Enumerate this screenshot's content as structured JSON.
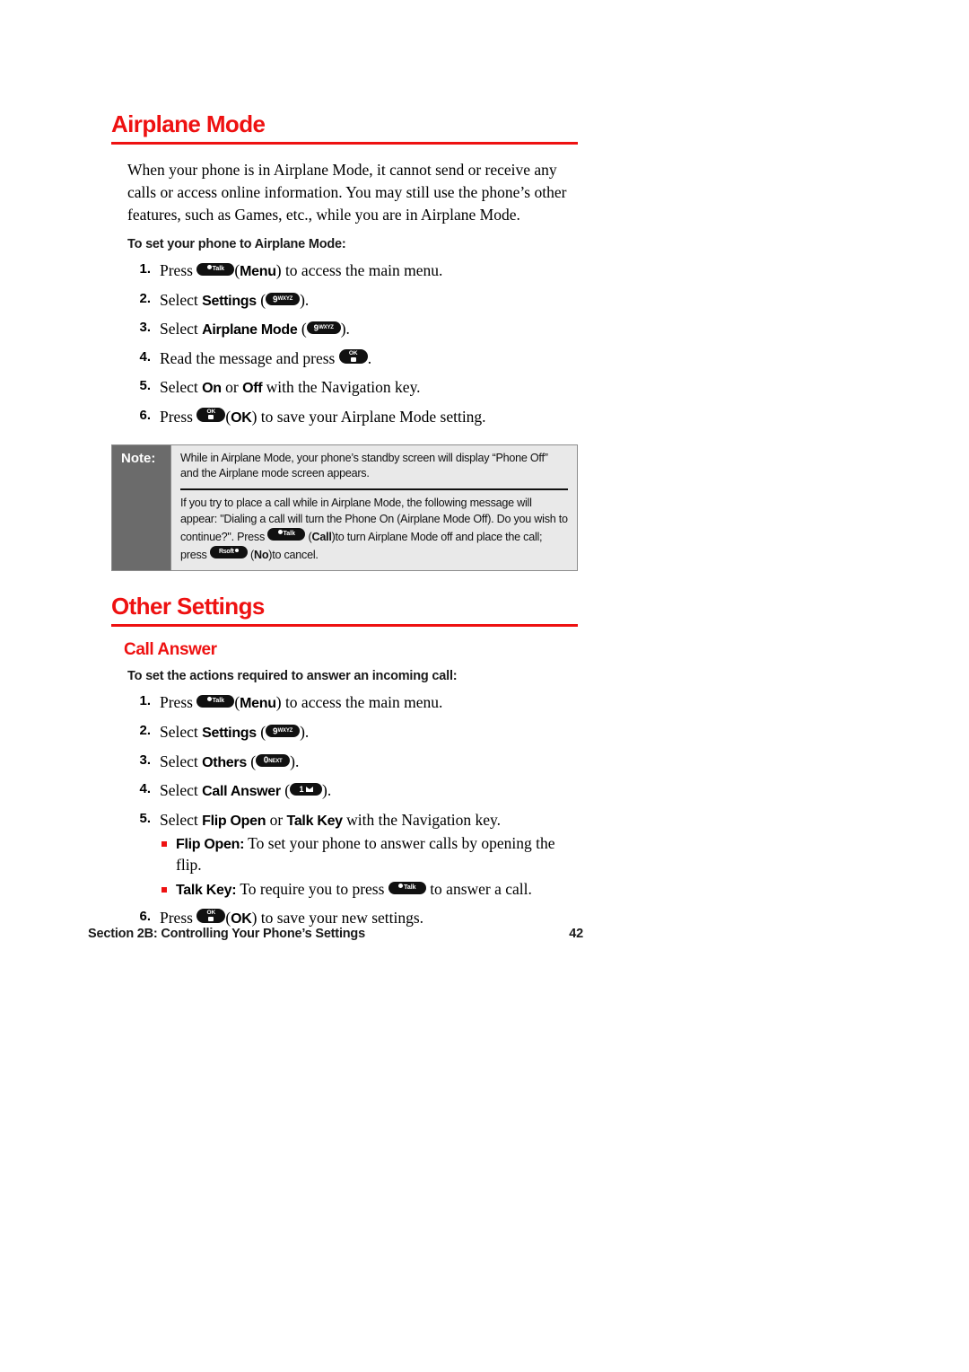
{
  "page": {
    "section_footer": "Section 2B: Controlling Your Phone’s Settings",
    "page_number": "42",
    "accent_color": "#ee1111"
  },
  "airplane": {
    "heading": "Airplane Mode",
    "intro": "When your phone is in Airplane Mode, it cannot send or receive any calls or access online information. You may still use the phone’s other features, such as Games, etc., while you are in Airplane Mode.",
    "lead_in": "To set your phone to Airplane Mode:",
    "steps": [
      {
        "num": "1.",
        "pre": "Press",
        "key": "talk-key",
        "key_label": "Talk",
        "paren_open": "(",
        "paren_label": "Menu",
        "paren_close": ")",
        "post": "to access the main menu."
      },
      {
        "num": "2.",
        "pre": "Select",
        "target": "Settings",
        "key": "key-9-wxyz",
        "key_digit": "9",
        "key_sub": "WXYZ",
        "post": "."
      },
      {
        "num": "3.",
        "pre": "Select",
        "target": "Airplane Mode",
        "key": "key-9-wxyz",
        "key_digit": "9",
        "key_sub": "WXYZ",
        "post": "."
      },
      {
        "num": "4.",
        "pre": "Read the message and press",
        "key": "ok-key",
        "key_label": "OK",
        "post": "."
      },
      {
        "num": "5.",
        "pre": "Select",
        "opt_a": "On",
        "conj": "or",
        "opt_b": "Off",
        "post": "with the Navigation key."
      },
      {
        "num": "6.",
        "pre": "Press",
        "key": "ok-key",
        "key_label": "OK",
        "paren_open": "(",
        "paren_label": "OK",
        "paren_close": ")",
        "post": "to save your Airplane Mode setting."
      }
    ],
    "note": {
      "label": "Note:",
      "para1": "While in Airplane Mode, your phone’s standby screen will display “Phone Off” and the Airplane mode screen appears.",
      "para2_a": "If you try to place a call while in Airplane Mode, the following message will appear: \"Dialing a call will turn the Phone On (Airplane Mode Off). Do you wish to continue?\".  Press",
      "para2_call_label": "Call",
      "para2_b": "to turn Airplane Mode off and place the call; press",
      "para2_no_label": "No",
      "para2_c": "to cancel."
    }
  },
  "other_settings": {
    "heading": "Other Settings",
    "subheading": "Call Answer",
    "lead_in": "To set the actions required to answer an incoming call:",
    "steps": [
      {
        "num": "1.",
        "pre": "Press",
        "key": "talk-key",
        "key_label": "Talk",
        "paren_open": "(",
        "paren_label": "Menu",
        "paren_close": ")",
        "post": "to access the main menu."
      },
      {
        "num": "2.",
        "pre": "Select",
        "target": "Settings",
        "key": "key-9-wxyz",
        "key_digit": "9",
        "key_sub": "WXYZ",
        "post": "."
      },
      {
        "num": "3.",
        "pre": "Select",
        "target": "Others",
        "key": "key-0-next",
        "key_digit": "0",
        "key_sub": "NEXT",
        "post": "."
      },
      {
        "num": "4.",
        "pre": "Select",
        "target": "Call Answer",
        "key": "key-1-envelope",
        "key_digit": "1",
        "post": "."
      },
      {
        "num": "5.",
        "pre": "Select",
        "opt_a": "Flip Open",
        "conj": "or",
        "opt_b": "Talk Key",
        "post": "with the Navigation key."
      }
    ],
    "bullets": [
      {
        "term": "Flip Open:",
        "text": "To set your phone to answer calls by opening the flip."
      },
      {
        "term": "Talk Key:",
        "pre": "To require you to press",
        "key": "talk-key",
        "key_label": "Talk",
        "post": "to answer a call."
      }
    ],
    "final_step": {
      "num": "6.",
      "pre": "Press",
      "key": "ok-key",
      "key_label": "OK",
      "paren_open": "(",
      "paren_label": "OK",
      "paren_close": ")",
      "post": "to save your new settings."
    }
  }
}
